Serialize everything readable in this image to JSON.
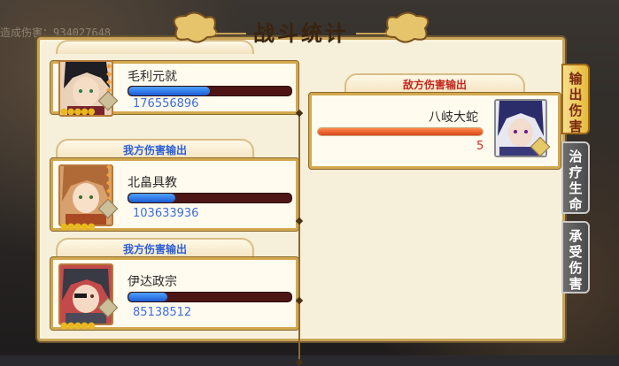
{
  "background": {
    "text": "造成伤害：934027648"
  },
  "title": "战斗统计",
  "side_tabs": [
    {
      "label": [
        "输",
        "出",
        "伤",
        "害"
      ],
      "active": true
    },
    {
      "label": [
        "治",
        "疗",
        "生",
        "命"
      ],
      "active": false
    },
    {
      "label": [
        "承",
        "受",
        "伤",
        "害"
      ],
      "active": false
    }
  ],
  "left_section_label": "我方伤害输出",
  "allies": [
    {
      "name": "毛利元就",
      "value": "176556896",
      "fill": 0.5
    },
    {
      "name": "北畠具教",
      "value": "103633936",
      "fill": 0.29
    },
    {
      "name": "伊达政宗",
      "value": "85138512",
      "fill": 0.24
    }
  ],
  "enemy_section_label": "敌方伤害输出",
  "enemy": {
    "name": "八岐大蛇",
    "value": "5",
    "fill": 1.0
  },
  "colors": {
    "ally_bar": "#2f7cec",
    "enemy_bar": "#e7592a",
    "panel": "#f6efd9"
  }
}
